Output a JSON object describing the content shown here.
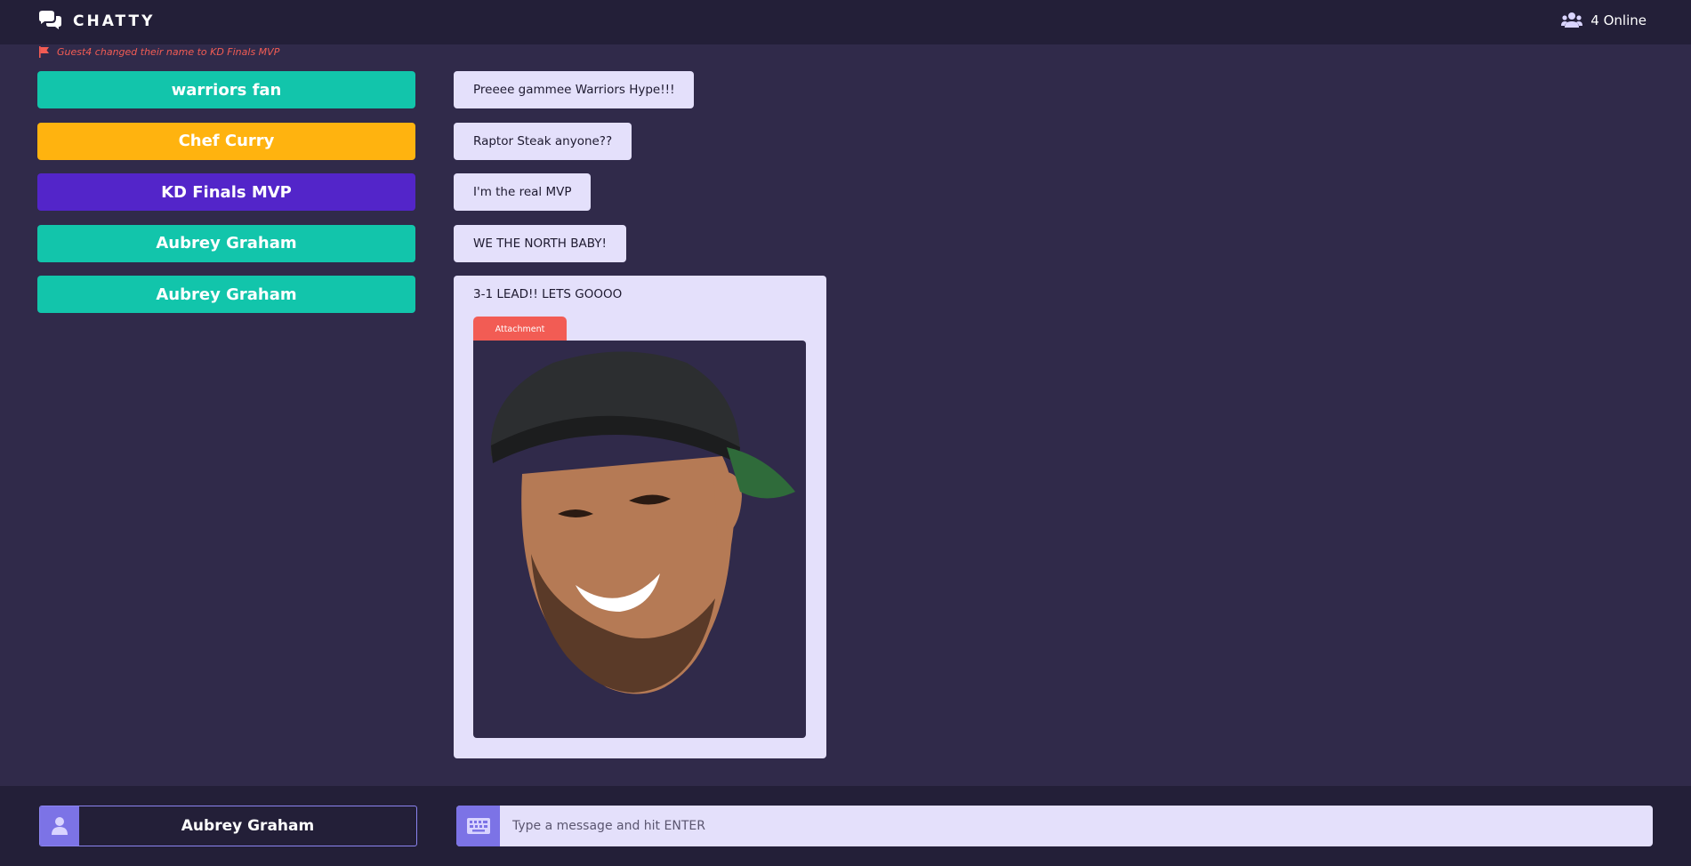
{
  "header": {
    "brand": "CHATTY",
    "online": "4 Online"
  },
  "notice": {
    "text": "Guest4 changed their name to KD Finals MVP"
  },
  "users": [
    {
      "name": "warriors fan",
      "color": "#12c5ab"
    },
    {
      "name": "Chef Curry",
      "color": "#ffb30f"
    },
    {
      "name": "KD Finals MVP",
      "color": "#5325c9"
    },
    {
      "name": "Aubrey Graham",
      "color": "#12c5ab"
    },
    {
      "name": "Aubrey Graham",
      "color": "#12c5ab"
    }
  ],
  "messages": [
    {
      "text": "Preeee gammee Warriors Hype!!!"
    },
    {
      "text": "Raptor Steak anyone??"
    },
    {
      "text": "I'm the real MVP"
    },
    {
      "text": "WE THE NORTH BABY!"
    }
  ],
  "attachment_message": {
    "text": "3-1 LEAD!! LETS GOOOO",
    "tab_label": "Attachment"
  },
  "composer": {
    "username": "Aubrey Graham",
    "placeholder": "Type a message and hit ENTER"
  },
  "colors": {
    "accent": "#7c73e6",
    "alert": "#f25c54",
    "background": "#302a4a",
    "bar": "#231f38"
  }
}
